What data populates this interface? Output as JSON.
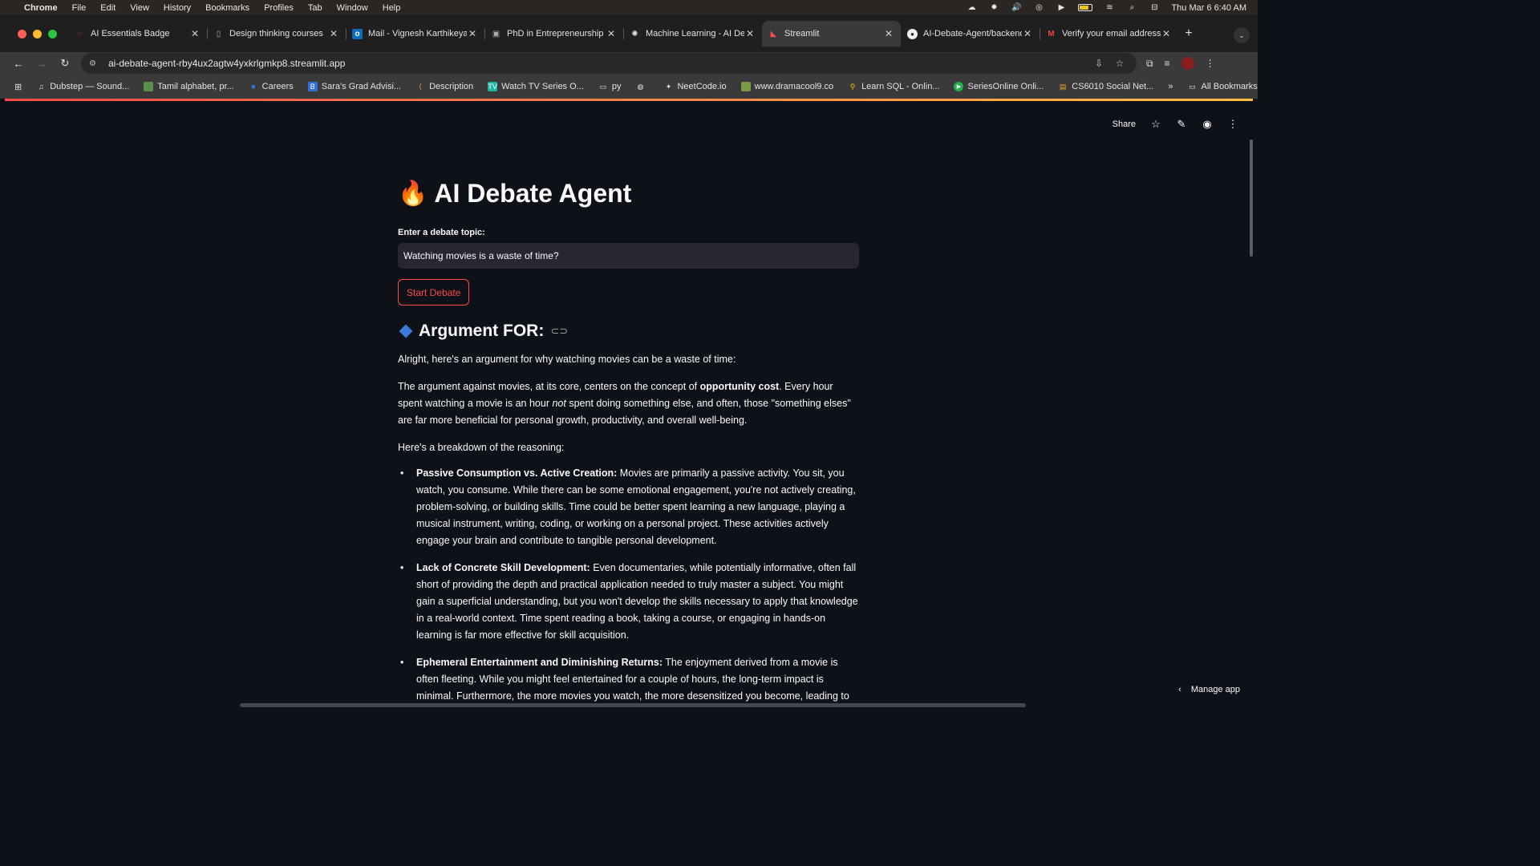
{
  "menubar": {
    "app": "Chrome",
    "items": [
      "File",
      "Edit",
      "View",
      "History",
      "Bookmarks",
      "Profiles",
      "Tab",
      "Window",
      "Help"
    ],
    "datetime": "Thu Mar 6  6:40 AM"
  },
  "tabs": [
    {
      "title": "AI Essentials Badge",
      "icon": "badge-icon",
      "active": false
    },
    {
      "title": "Design thinking courses",
      "icon": "page-icon",
      "active": false
    },
    {
      "title": "Mail - Vignesh Karthikeyan",
      "icon": "outlook-icon",
      "active": false
    },
    {
      "title": "PhD in Entrepreneurship",
      "icon": "page-icon",
      "active": false
    },
    {
      "title": "Machine Learning - AI De",
      "icon": "openai-icon",
      "active": false
    },
    {
      "title": "Streamlit",
      "icon": "streamlit-icon",
      "active": true
    },
    {
      "title": "AI-Debate-Agent/backend",
      "icon": "github-icon",
      "active": false
    },
    {
      "title": "Verify your email address",
      "icon": "gmail-icon",
      "active": false
    }
  ],
  "toolbar": {
    "url": "ai-debate-agent-rby4ux2agtw4yxkrlgmkp8.streamlit.app"
  },
  "bookmarks": [
    {
      "label": "Dubstep — Sound...",
      "icon": "soundcloud-icon"
    },
    {
      "label": "Tamil alphabet, pr...",
      "icon": "image-icon"
    },
    {
      "label": "Careers",
      "icon": "briefcase-icon"
    },
    {
      "label": "Sara's Grad Advisi...",
      "icon": "doc-icon"
    },
    {
      "label": "Description",
      "icon": "leetcode-icon"
    },
    {
      "label": "Watch TV Series O...",
      "icon": "tv-icon"
    },
    {
      "label": "py",
      "icon": "folder-icon"
    },
    {
      "label": "",
      "icon": "globe-icon"
    },
    {
      "label": "NeetCode.io",
      "icon": "rocket-icon"
    },
    {
      "label": "www.dramacool9.co",
      "icon": "image-icon"
    },
    {
      "label": "Learn SQL - Onlin...",
      "icon": "bulb-icon"
    },
    {
      "label": "SeriesOnline  Onli...",
      "icon": "play-icon"
    },
    {
      "label": "CS6010 Social Net...",
      "icon": "doc-icon"
    }
  ],
  "bookmarks_right": {
    "all_label": "All Bookmarks"
  },
  "app_header": {
    "share_label": "Share"
  },
  "page": {
    "title": "AI Debate Agent",
    "title_emoji": "🔥",
    "topic_label": "Enter a debate topic:",
    "topic_value": "Watching movies is a waste of time?",
    "start_button": "Start Debate",
    "section_heading": "Argument FOR:",
    "intro": "Alright, here's an argument for why watching movies can be a waste of time:",
    "p2": {
      "a": "The argument against movies, at its core, centers on the concept of ",
      "b": "opportunity cost",
      "c": ". Every hour spent watching a movie is an hour ",
      "d": "not",
      "e": " spent doing something else, and often, those \"something elses\" are far more beneficial for personal growth, productivity, and overall well-being."
    },
    "breakdown_intro": "Here's a breakdown of the reasoning:",
    "reasons": [
      {
        "title": "Passive Consumption vs. Active Creation:",
        "text": " Movies are primarily a passive activity. You sit, you watch, you consume. While there can be some emotional engagement, you're not actively creating, problem-solving, or building skills. Time could be better spent learning a new language, playing a musical instrument, writing, coding, or working on a personal project. These activities actively engage your brain and contribute to tangible personal development."
      },
      {
        "title": "Lack of Concrete Skill Development:",
        "text": " Even documentaries, while potentially informative, often fall short of providing the depth and practical application needed to truly master a subject. You might gain a superficial understanding, but you won't develop the skills necessary to apply that knowledge in a real-world context. Time spent reading a book, taking a course, or engaging in hands-on learning is far more effective for skill acquisition."
      },
      {
        "title": "Ephemeral Entertainment and Diminishing Returns:",
        "text": " The enjoyment derived from a movie is often fleeting. While you might feel entertained for a couple of hours, the long-term impact is minimal. Furthermore, the more movies you watch, the more desensitized you become, leading to diminishing"
      }
    ]
  },
  "footer": {
    "manage_app": "Manage app"
  },
  "colors": {
    "accent": "#ff4b4b",
    "background": "#0e1117",
    "input_bg": "#262730"
  }
}
